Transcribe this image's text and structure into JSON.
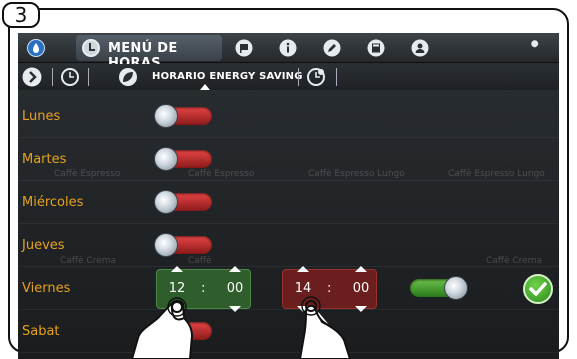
{
  "step_number": "3",
  "topbar": {
    "active_tab_label": "MENÚ DE HORAS",
    "icons": [
      "water-drop-icon",
      "clock-icon",
      "flag-icon",
      "info-icon",
      "pencil-icon",
      "calculator-icon",
      "user-icon",
      "wrench-icon"
    ]
  },
  "subbar": {
    "active_label": "HORARIO ENERGY SAVING",
    "icons": [
      "arrow-right-icon",
      "clock-power-icon",
      "leaf-icon",
      "clock-drop-icon"
    ]
  },
  "days": [
    {
      "label": "Lunes",
      "enabled": false
    },
    {
      "label": "Martes",
      "enabled": false
    },
    {
      "label": "Miércoles",
      "enabled": false
    },
    {
      "label": "Jueves",
      "enabled": false
    },
    {
      "label": "Viernes",
      "enabled": true
    },
    {
      "label": "Sabat",
      "enabled": false
    }
  ],
  "friday_schedule": {
    "start_hour": "12",
    "start_min": "00",
    "end_hour": "14",
    "end_min": "00",
    "separator": ":"
  },
  "background_ghost_text": [
    "Caffè Espresso",
    "Caffè Espresso",
    "Caffè Espresso Lungo",
    "Caffè Espresso Lungo",
    "Caffè Crema",
    "Caffè",
    "Caffè Crema"
  ],
  "colors": {
    "day_label": "#e7a21c",
    "toggle_off": "#d63a3a",
    "toggle_on": "#4fa83a",
    "start_picker": "#2f5d2c",
    "end_picker": "#6a1e1e"
  }
}
